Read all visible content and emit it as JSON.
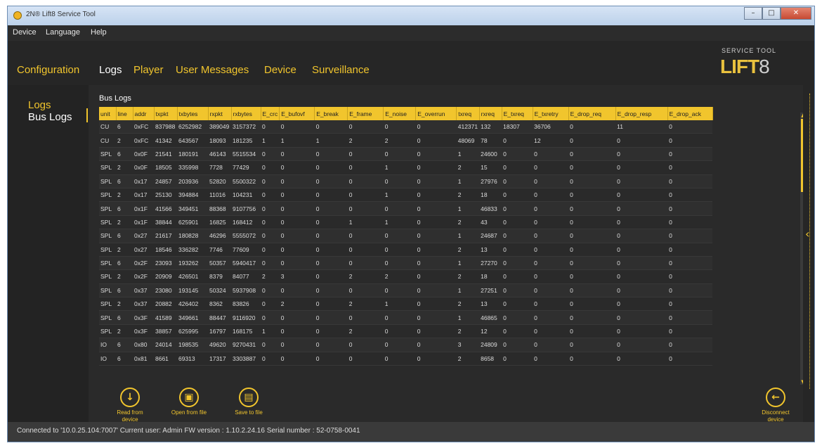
{
  "window": {
    "title": "2N® Lift8 Service Tool",
    "minimize": "–",
    "maximize": "□",
    "close": "✕"
  },
  "menu": [
    "Device",
    "Language",
    "Help"
  ],
  "tabs": [
    "Configuration",
    "Logs",
    "Player",
    "User Messages",
    "Device",
    "Surveillance"
  ],
  "active_tab": "Logs",
  "logo": {
    "sub": "SERVICE TOOL",
    "main": "LIFT",
    "digit": "8"
  },
  "sidebar": {
    "items": [
      "Logs",
      "Bus Logs"
    ],
    "active": "Bus Logs"
  },
  "bus_logs": {
    "title": "Bus Logs",
    "columns": [
      "unit",
      "line",
      "addr",
      "txpkt",
      "txbytes",
      "rxpkt",
      "rxbytes",
      "E_crc",
      "E_bufovf",
      "E_break",
      "E_frame",
      "E_noise",
      "E_overrun",
      "txreq",
      "rxreq",
      "E_txreq",
      "E_txretry",
      "E_drop_req",
      "E_drop_resp",
      "E_drop_ack"
    ],
    "rows": [
      [
        "CU",
        "6",
        "0xFC",
        "837988",
        "6252982",
        "389049",
        "3157372",
        "0",
        "0",
        "0",
        "0",
        "0",
        "0",
        "412371",
        "132",
        "18307",
        "36706",
        "0",
        "11",
        "0"
      ],
      [
        "CU",
        "2",
        "0xFC",
        "41342",
        "643567",
        "18093",
        "181235",
        "1",
        "1",
        "1",
        "2",
        "2",
        "0",
        "48069",
        "78",
        "0",
        "12",
        "0",
        "0",
        "0"
      ],
      [
        "SPL",
        "6",
        "0x0F",
        "21541",
        "180191",
        "46143",
        "5515534",
        "0",
        "0",
        "0",
        "0",
        "0",
        "0",
        "1",
        "24600",
        "0",
        "0",
        "0",
        "0",
        "0"
      ],
      [
        "SPL",
        "2",
        "0x0F",
        "18505",
        "335998",
        "7728",
        "77429",
        "0",
        "0",
        "0",
        "0",
        "1",
        "0",
        "2",
        "15",
        "0",
        "0",
        "0",
        "0",
        "0"
      ],
      [
        "SPL",
        "6",
        "0x17",
        "24857",
        "203936",
        "52820",
        "5500322",
        "0",
        "0",
        "0",
        "0",
        "0",
        "0",
        "1",
        "27976",
        "0",
        "0",
        "0",
        "0",
        "0"
      ],
      [
        "SPL",
        "2",
        "0x17",
        "25130",
        "394884",
        "11016",
        "104231",
        "0",
        "0",
        "0",
        "0",
        "1",
        "0",
        "2",
        "18",
        "0",
        "0",
        "0",
        "0",
        "0"
      ],
      [
        "SPL",
        "6",
        "0x1F",
        "41566",
        "349451",
        "88368",
        "9107756",
        "0",
        "0",
        "0",
        "0",
        "0",
        "0",
        "1",
        "46833",
        "0",
        "0",
        "0",
        "0",
        "0"
      ],
      [
        "SPL",
        "2",
        "0x1F",
        "38844",
        "625901",
        "16825",
        "168412",
        "0",
        "0",
        "0",
        "1",
        "1",
        "0",
        "2",
        "43",
        "0",
        "0",
        "0",
        "0",
        "0"
      ],
      [
        "SPL",
        "6",
        "0x27",
        "21617",
        "180828",
        "46296",
        "5555072",
        "0",
        "0",
        "0",
        "0",
        "0",
        "0",
        "1",
        "24687",
        "0",
        "0",
        "0",
        "0",
        "0"
      ],
      [
        "SPL",
        "2",
        "0x27",
        "18546",
        "336282",
        "7746",
        "77609",
        "0",
        "0",
        "0",
        "0",
        "0",
        "0",
        "2",
        "13",
        "0",
        "0",
        "0",
        "0",
        "0"
      ],
      [
        "SPL",
        "6",
        "0x2F",
        "23093",
        "193262",
        "50357",
        "5940417",
        "0",
        "0",
        "0",
        "0",
        "0",
        "0",
        "1",
        "27270",
        "0",
        "0",
        "0",
        "0",
        "0"
      ],
      [
        "SPL",
        "2",
        "0x2F",
        "20909",
        "426501",
        "8379",
        "84077",
        "2",
        "3",
        "0",
        "2",
        "2",
        "0",
        "2",
        "18",
        "0",
        "0",
        "0",
        "0",
        "0"
      ],
      [
        "SPL",
        "6",
        "0x37",
        "23080",
        "193145",
        "50324",
        "5937908",
        "0",
        "0",
        "0",
        "0",
        "0",
        "0",
        "1",
        "27251",
        "0",
        "0",
        "0",
        "0",
        "0"
      ],
      [
        "SPL",
        "2",
        "0x37",
        "20882",
        "426402",
        "8362",
        "83826",
        "0",
        "2",
        "0",
        "2",
        "1",
        "0",
        "2",
        "13",
        "0",
        "0",
        "0",
        "0",
        "0"
      ],
      [
        "SPL",
        "6",
        "0x3F",
        "41589",
        "349661",
        "88447",
        "9116920",
        "0",
        "0",
        "0",
        "0",
        "0",
        "0",
        "1",
        "46865",
        "0",
        "0",
        "0",
        "0",
        "0"
      ],
      [
        "SPL",
        "2",
        "0x3F",
        "38857",
        "625995",
        "16797",
        "168175",
        "1",
        "0",
        "0",
        "2",
        "0",
        "0",
        "2",
        "12",
        "0",
        "0",
        "0",
        "0",
        "0"
      ],
      [
        "IO",
        "6",
        "0x80",
        "24014",
        "198535",
        "49620",
        "9270431",
        "0",
        "0",
        "0",
        "0",
        "0",
        "0",
        "3",
        "24809",
        "0",
        "0",
        "0",
        "0",
        "0"
      ],
      [
        "IO",
        "6",
        "0x81",
        "8661",
        "69313",
        "17317",
        "3303887",
        "0",
        "0",
        "0",
        "0",
        "0",
        "0",
        "2",
        "8658",
        "0",
        "0",
        "0",
        "0",
        "0"
      ]
    ]
  },
  "actions": {
    "read": {
      "icon": "↓",
      "label": "Read from device"
    },
    "open": {
      "icon": "▣",
      "label": "Open from file"
    },
    "save": {
      "icon": "▤",
      "label": "Save to file"
    },
    "disconnect": {
      "icon": "←",
      "label": "Disconnect device"
    }
  },
  "status": "Connected to '10.0.25.104:7007'   Current user: Admin   FW version : 1.10.2.24.16   Serial number : 52-0758-0041",
  "colors": {
    "accent": "#f1c52d",
    "background": "#2a2a2a"
  }
}
